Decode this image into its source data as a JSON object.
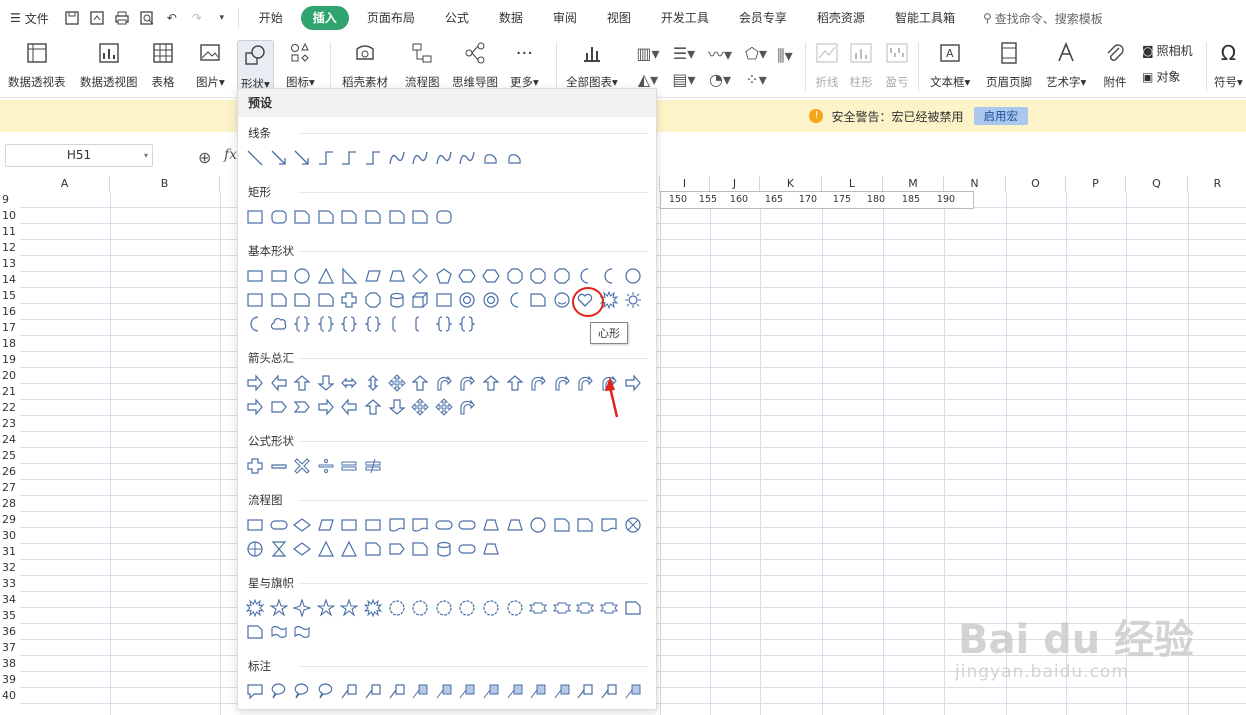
{
  "menubar": {
    "file_label": "文件",
    "tabs": [
      "开始",
      "插入",
      "页面布局",
      "公式",
      "数据",
      "审阅",
      "视图",
      "开发工具",
      "会员专享",
      "稻壳资源",
      "智能工具箱"
    ],
    "active_tab": "插入",
    "search_placeholder": "查找命令、搜索模板"
  },
  "ribbon": {
    "pivot_table": "数据透视表",
    "pivot_chart": "数据透视图",
    "table": "表格",
    "picture": "图片",
    "shape": "形状",
    "icon": "图标",
    "docer_material": "稻壳素材",
    "flowchart": "流程图",
    "mindmap": "思维导图",
    "more": "更多",
    "all_charts": "全部图表",
    "sparkline_line": "折线",
    "sparkline_column": "柱形",
    "sparkline_winloss": "盈亏",
    "textbox": "文本框",
    "header_footer": "页眉页脚",
    "wordart": "艺术字",
    "attachment": "附件",
    "camera": "照相机",
    "object": "对象",
    "symbol": "符号"
  },
  "warning": {
    "text": "安全警告：宏已经被禁用",
    "button": "启用宏"
  },
  "formula": {
    "name_box": "H51",
    "fx": "fx"
  },
  "sheet": {
    "columns": [
      "A",
      "B",
      "I",
      "J",
      "K",
      "L",
      "M",
      "N",
      "O",
      "P",
      "Q",
      "R"
    ],
    "rows": [
      "9",
      "10",
      "11",
      "12",
      "13",
      "14",
      "15",
      "16",
      "17",
      "18",
      "19",
      "20",
      "21",
      "22",
      "23",
      "24",
      "25",
      "26",
      "27",
      "28",
      "29",
      "30",
      "31",
      "32",
      "33",
      "34",
      "35",
      "36",
      "37",
      "38",
      "39",
      "40"
    ],
    "row9_values": [
      "150",
      "155",
      "160",
      "165",
      "170",
      "175",
      "180",
      "185",
      "190"
    ]
  },
  "shapes_panel": {
    "header": "预设",
    "sections": {
      "lines": "线条",
      "rect": "矩形",
      "basic": "基本形状",
      "arrows": "箭头总汇",
      "equation": "公式形状",
      "flowchart": "流程图",
      "stars": "星与旗帜",
      "callouts": "标注"
    },
    "tooltip": "心形"
  },
  "watermark": {
    "brand": "Bai du 经验",
    "url": "jingyan.baidu.com"
  },
  "colors": {
    "accent": "#2fa46f",
    "highlight": "#e0241b",
    "shape_stroke": "#4a6fa8",
    "warn_bg": "#fdf3c8"
  }
}
